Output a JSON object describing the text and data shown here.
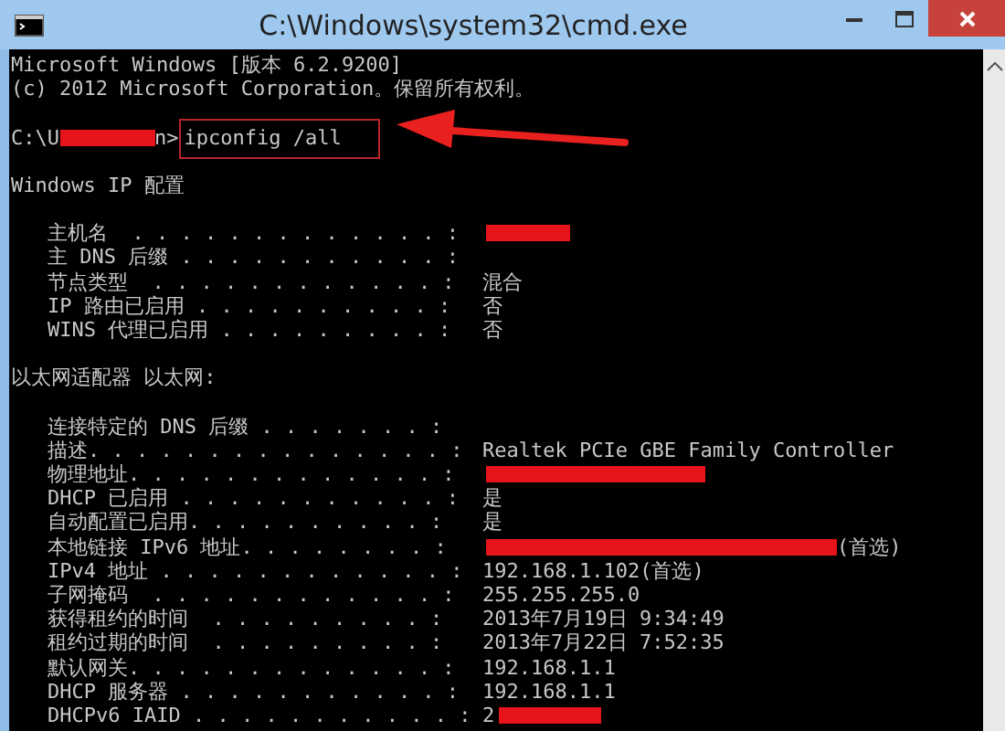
{
  "window": {
    "title": "C:\\Windows\\system32\\cmd.exe"
  },
  "console": [
    {
      "kind": "text",
      "text": "Microsoft Windows [版本 6.2.9200]"
    },
    {
      "kind": "text",
      "text": "(c) 2012 Microsoft Corporation。保留所有权利。"
    },
    {
      "kind": "blank"
    },
    {
      "kind": "prompt",
      "parts": [
        {
          "kind": "text",
          "text": "C:\\U"
        },
        {
          "kind": "redacted"
        },
        {
          "kind": "text",
          "text": "n>"
        },
        {
          "kind": "command",
          "text": "ipconfig /all"
        }
      ]
    },
    {
      "kind": "blank"
    },
    {
      "kind": "text",
      "text": "Windows IP 配置"
    },
    {
      "kind": "blank"
    },
    {
      "kind": "field",
      "label": "主机名  . . . . . . . . . . . . . :",
      "parts": [
        {
          "kind": "redacted"
        }
      ]
    },
    {
      "kind": "field",
      "label": "主 DNS 后缀 . . . . . . . . . . . :"
    },
    {
      "kind": "field",
      "label": "节点类型  . . . . . . . . . . . . :",
      "parts": [
        {
          "kind": "text",
          "text": "混合"
        }
      ]
    },
    {
      "kind": "field",
      "label": "IP 路由已启用 . . . . . . . . . . :",
      "parts": [
        {
          "kind": "text",
          "text": "否"
        }
      ]
    },
    {
      "kind": "field",
      "label": "WINS 代理已启用 . . . . . . . . . :",
      "parts": [
        {
          "kind": "text",
          "text": "否"
        }
      ]
    },
    {
      "kind": "blank"
    },
    {
      "kind": "text",
      "text": "以太网适配器 以太网:"
    },
    {
      "kind": "blank"
    },
    {
      "kind": "field",
      "label": "连接特定的 DNS 后缀 . . . . . . . :"
    },
    {
      "kind": "field",
      "label": "描述. . . . . . . . . . . . . . . :",
      "parts": [
        {
          "kind": "text",
          "text": "Realtek PCIe GBE Family Controller"
        }
      ]
    },
    {
      "kind": "field",
      "label": "物理地址. . . . . . . . . . . . . :",
      "parts": [
        {
          "kind": "redacted"
        }
      ]
    },
    {
      "kind": "field",
      "label": "DHCP 已启用 . . . . . . . . . . . :",
      "parts": [
        {
          "kind": "text",
          "text": "是"
        }
      ]
    },
    {
      "kind": "field",
      "label": "自动配置已启用. . . . . . . . . . :",
      "parts": [
        {
          "kind": "text",
          "text": "是"
        }
      ]
    },
    {
      "kind": "field",
      "label": "本地链接 IPv6 地址. . . . . . . . :",
      "parts": [
        {
          "kind": "redacted"
        },
        {
          "kind": "text",
          "text": "(首选)"
        }
      ]
    },
    {
      "kind": "field",
      "label": "IPv4 地址 . . . . . . . . . . . . :",
      "parts": [
        {
          "kind": "text",
          "text": "192.168.1.102(首选)"
        }
      ]
    },
    {
      "kind": "field",
      "label": "子网掩码  . . . . . . . . . . . . :",
      "parts": [
        {
          "kind": "text",
          "text": "255.255.255.0"
        }
      ]
    },
    {
      "kind": "field",
      "label": "获得租约的时间  . . . . . . . . . :",
      "parts": [
        {
          "kind": "text",
          "text": "2013年7月19日 9:34:49"
        }
      ]
    },
    {
      "kind": "field",
      "label": "租约过期的时间  . . . . . . . . . :",
      "parts": [
        {
          "kind": "text",
          "text": "2013年7月22日 7:52:35"
        }
      ]
    },
    {
      "kind": "field",
      "label": "默认网关. . . . . . . . . . . . . :",
      "parts": [
        {
          "kind": "text",
          "text": "192.168.1.1"
        }
      ]
    },
    {
      "kind": "field",
      "label": "DHCP 服务器 . . . . . . . . . . . :",
      "parts": [
        {
          "kind": "text",
          "text": "192.168.1.1"
        }
      ]
    },
    {
      "kind": "field",
      "label": "DHCPv6 IAID . . . . . . . . . . . :",
      "parts": [
        {
          "kind": "text",
          "text": "2"
        },
        {
          "kind": "redacted"
        }
      ]
    }
  ]
}
